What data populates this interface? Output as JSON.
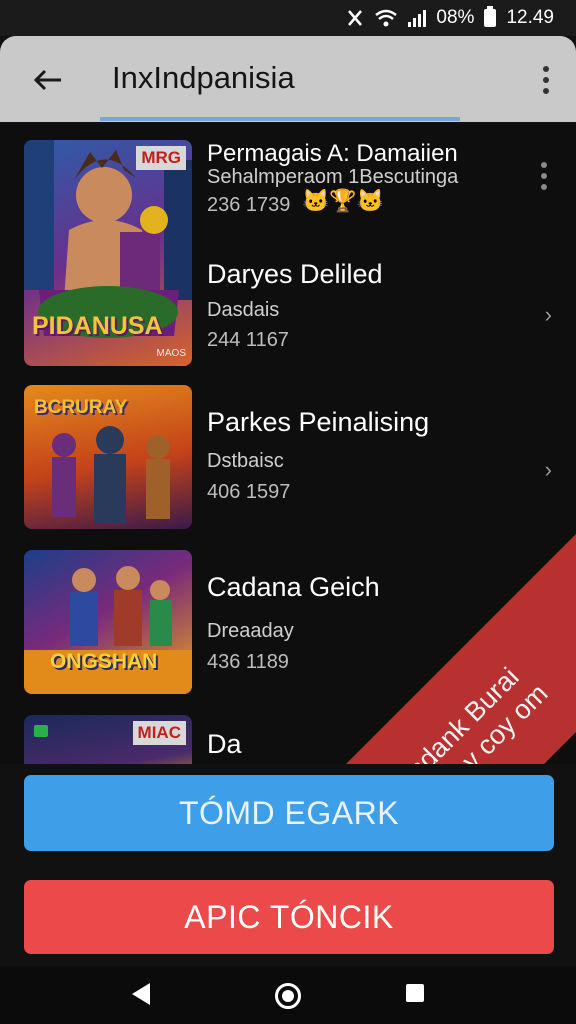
{
  "status_bar": {
    "battery_text": "08%",
    "time": "12.49"
  },
  "app_bar": {
    "title": "InxIndpanisia"
  },
  "items": [
    {
      "title": "Permagais A: Damaiien",
      "subtitle": "Sehalmperaom 1Bescutinga",
      "number": "236 1739",
      "emoji": "🐱🏆🐱",
      "badge": "MRG",
      "thumb_caption": "PIDANUSA",
      "thumb_footer": "MAOS"
    },
    {
      "title": "Daryes Deliled",
      "subtitle": "Dasdais",
      "number": "244 1167",
      "badge": "",
      "thumb_caption": "",
      "thumb_footer": ""
    },
    {
      "title": "Parkes Peinalising",
      "subtitle": "Dstbaisc",
      "number": "406 1597",
      "badge": "",
      "thumb_caption": "BCRURAY",
      "thumb_footer": ""
    },
    {
      "title": "Cadana Geich",
      "subtitle": "Dreaaday",
      "number": "436 1189",
      "badge": "",
      "thumb_caption": "ONGSHAN",
      "thumb_footer": ""
    },
    {
      "title": "Da",
      "subtitle": "",
      "number": "",
      "badge": "MIAC",
      "thumb_caption": "",
      "thumb_footer": ""
    }
  ],
  "ribbon": {
    "line1": "Pamdank Burai",
    "line2": "menilaay coy om"
  },
  "buttons": {
    "primary": "TÓMD EGARK",
    "danger": "APIC TÓNCIK"
  },
  "colors": {
    "primary": "#3e9fe8",
    "danger": "#ec4a4a",
    "ribbon": "#b73131",
    "app_bar": "#c9c9c9"
  }
}
